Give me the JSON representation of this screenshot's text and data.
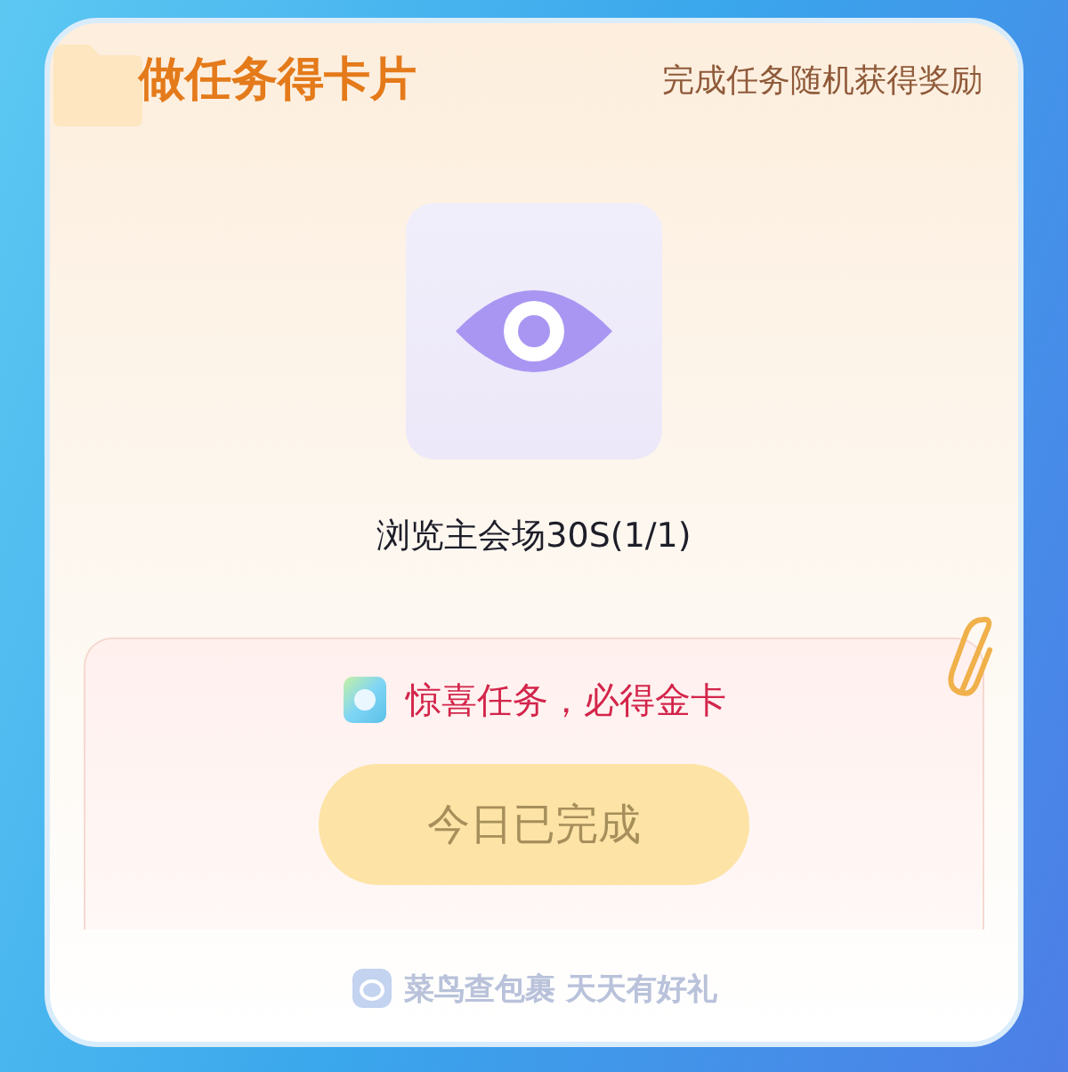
{
  "header": {
    "title": "做任务得卡片",
    "subtitle": "完成任务随机获得奖励"
  },
  "task": {
    "name": "浏览主会场30S(1/1)"
  },
  "bonus": {
    "text": "惊喜任务，必得金卡"
  },
  "action_button": {
    "label": "今日已完成",
    "disabled": true
  },
  "footer": {
    "brand": "菜鸟查包裹",
    "slogan": "天天有好礼"
  }
}
